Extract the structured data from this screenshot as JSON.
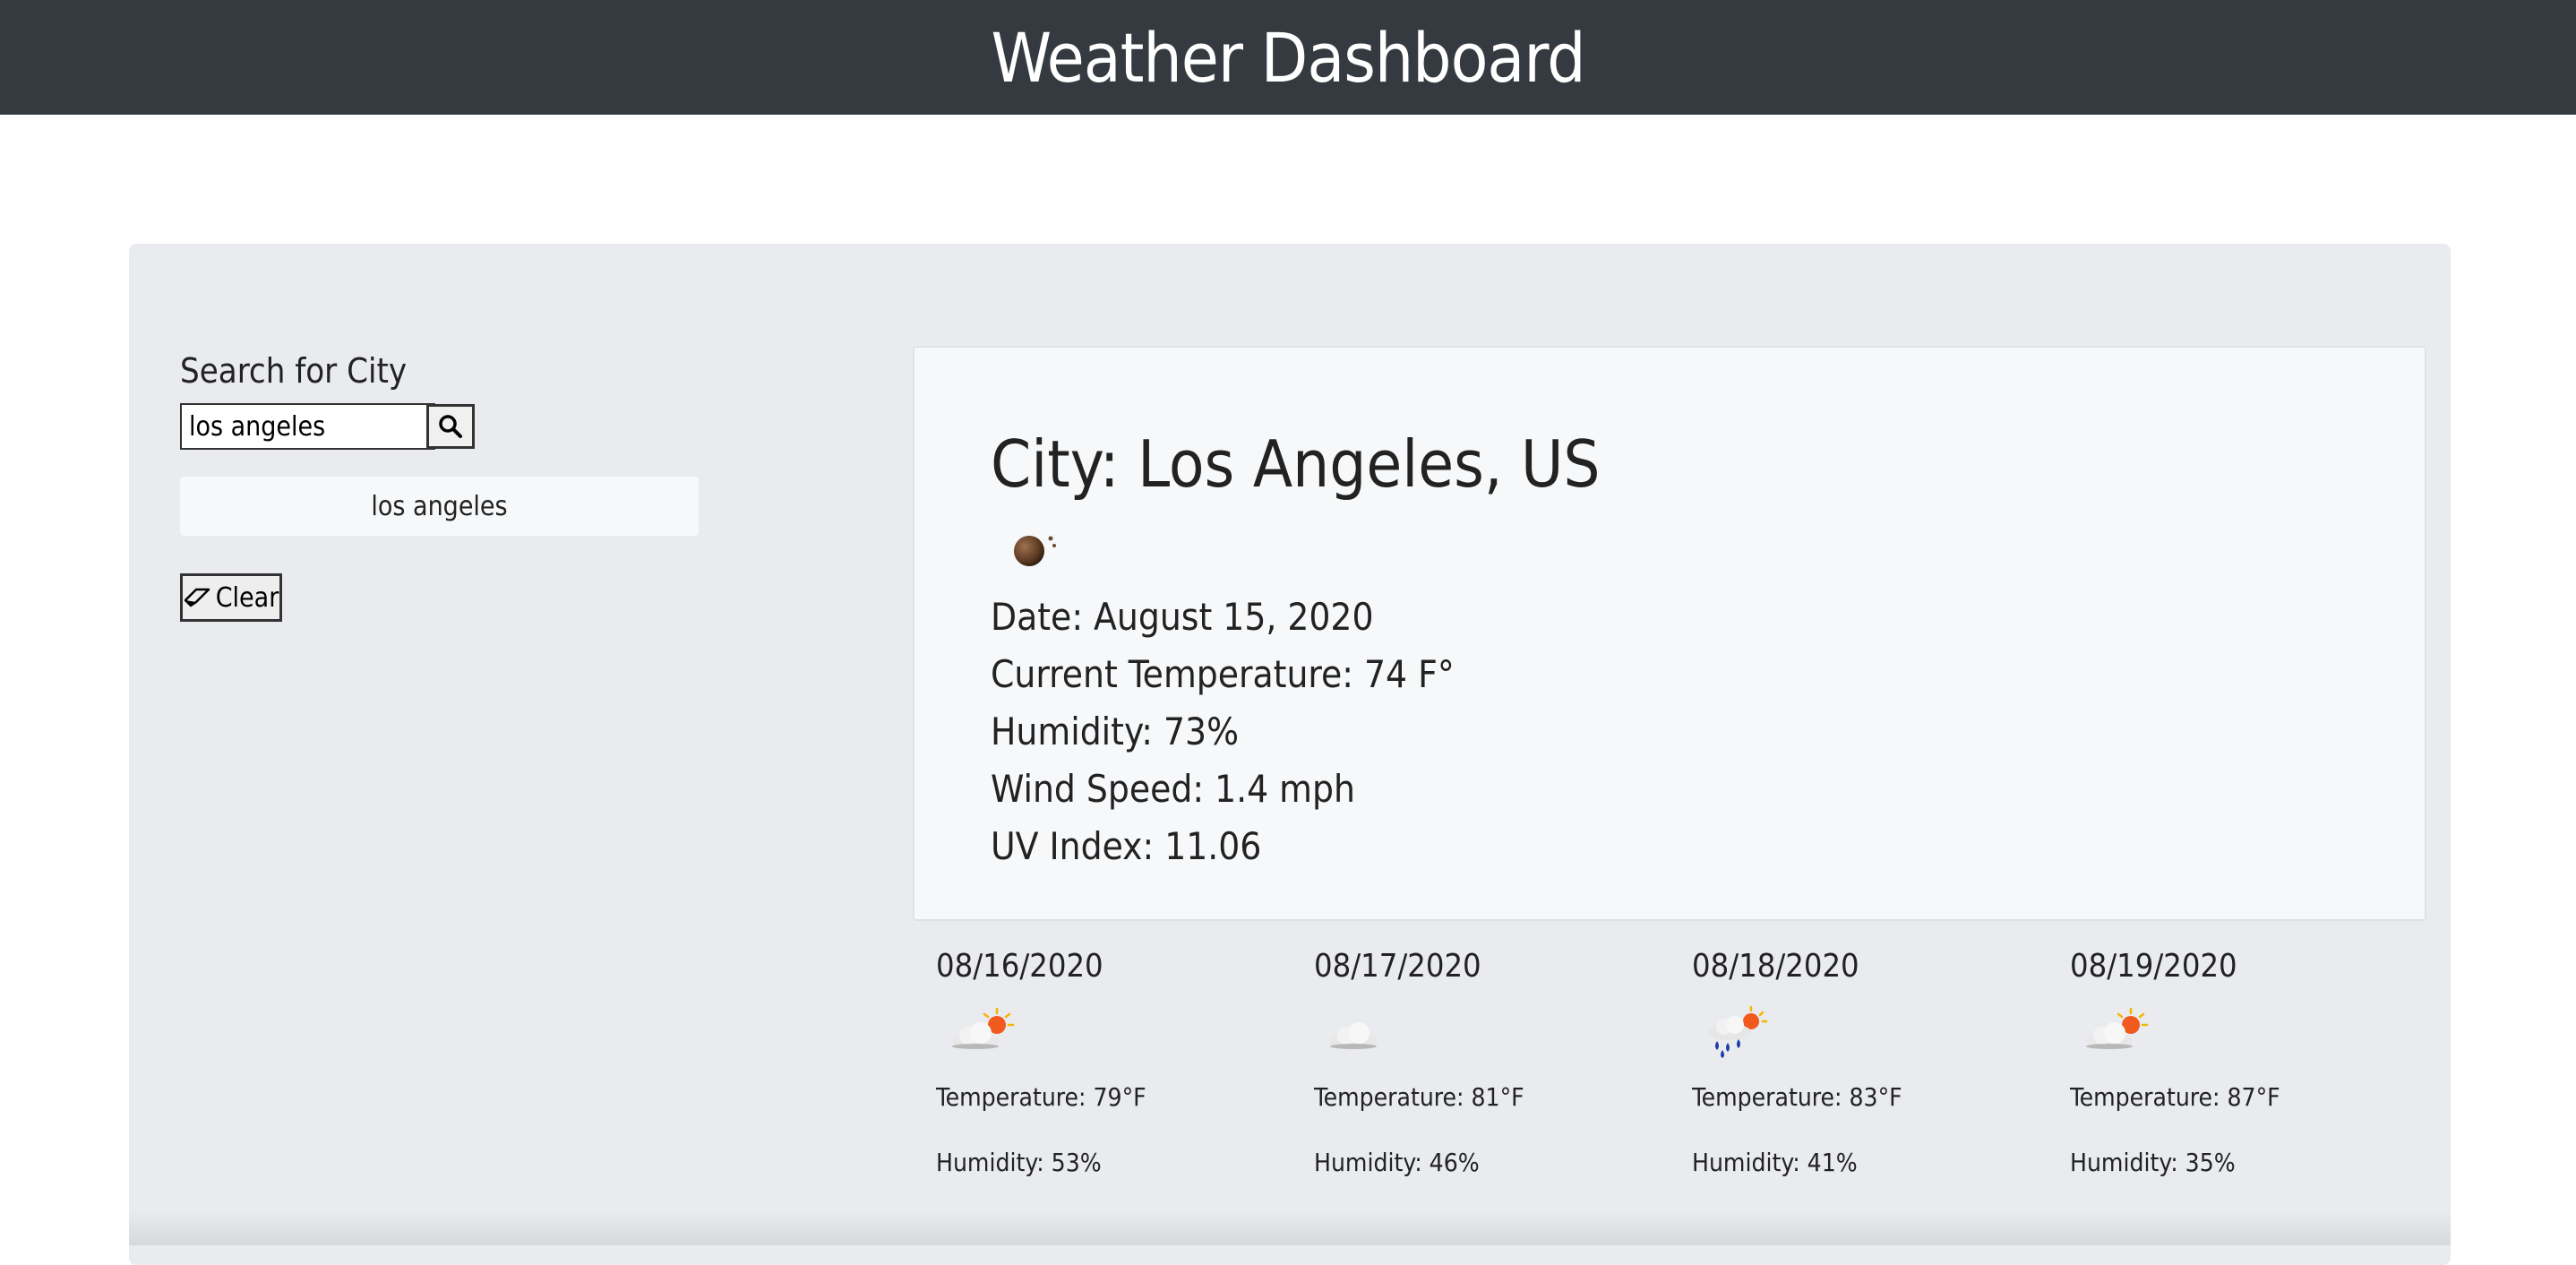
{
  "header": {
    "title": "Weather Dashboard"
  },
  "search": {
    "label": "Search for City",
    "value": "los angeles",
    "button_icon": "search-icon"
  },
  "history": [
    {
      "label": "los angeles"
    }
  ],
  "clear_button": {
    "label": "Clear",
    "icon": "eraser-icon"
  },
  "current": {
    "city": "City: Los Angeles, US",
    "icon": "hazy-night-icon",
    "date": "Date: August 15, 2020",
    "temperature": "Current Temperature: 74 F°",
    "humidity": "Humidity: 73%",
    "wind": "Wind Speed: 1.4 mph",
    "uv": "UV Index: 11.06"
  },
  "forecast": [
    {
      "date": "08/16/2020",
      "icon": "partly-cloudy-icon",
      "temperature": "Temperature: 79°F",
      "humidity": "Humidity: 53%"
    },
    {
      "date": "08/17/2020",
      "icon": "cloud-icon",
      "temperature": "Temperature: 81°F",
      "humidity": "Humidity: 46%"
    },
    {
      "date": "08/18/2020",
      "icon": "rain-sun-icon",
      "temperature": "Temperature: 83°F",
      "humidity": "Humidity: 41%"
    },
    {
      "date": "08/19/2020",
      "icon": "partly-cloudy-icon",
      "temperature": "Temperature: 87°F",
      "humidity": "Humidity: 35%"
    }
  ]
}
